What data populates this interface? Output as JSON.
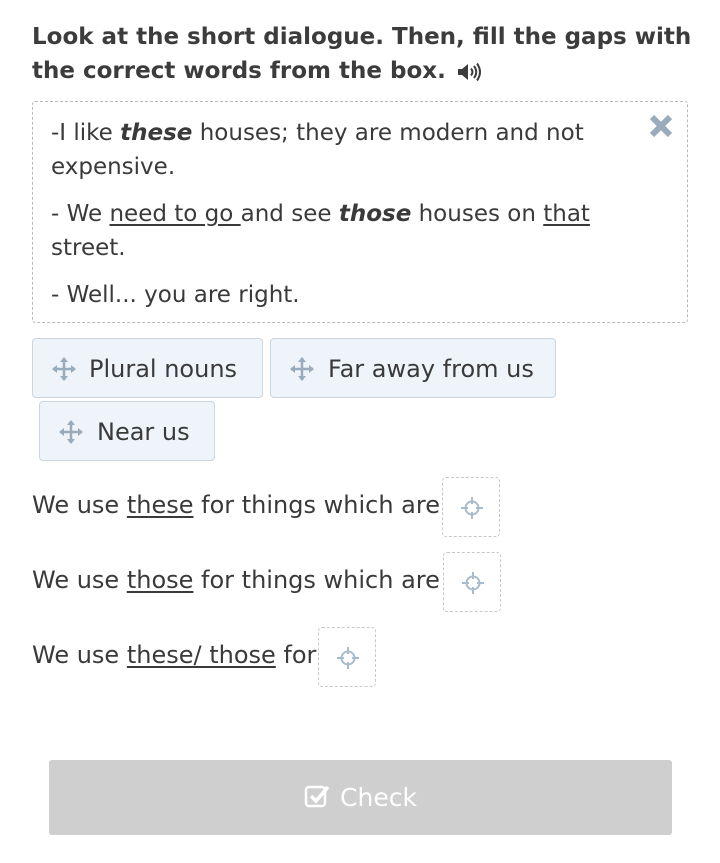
{
  "instructions": "Look at the short dialogue. Then, fill the gaps with the correct words from the box.",
  "dialogue": {
    "line1_pre": "-I like ",
    "line1_em": "these",
    "line1_post": " houses; they are modern and not expensive.",
    "line2_pre": "- We ",
    "line2_u1": "need to go ",
    "line2_mid": "and see ",
    "line2_em": "those",
    "line2_mid2": " houses on ",
    "line2_u2": "that",
    "line2_post": " street.",
    "line3": "- Well... you are right."
  },
  "chips": [
    {
      "label": "Plural nouns"
    },
    {
      "label": "Far away from us"
    },
    {
      "label": "Near us"
    }
  ],
  "questions": [
    {
      "pre": "We use ",
      "word": "these",
      "post": " for things which are"
    },
    {
      "pre": "We use ",
      "word": "those",
      "post": " for things which are"
    },
    {
      "pre": "We use ",
      "word": "these/ those",
      "post": " for"
    }
  ],
  "check_label": "Check",
  "colors": {
    "chip_bg": "#eef4f9",
    "chip_border": "#cad6e0",
    "icon": "#9aacbb",
    "button_disabled": "#cfcfcf"
  }
}
